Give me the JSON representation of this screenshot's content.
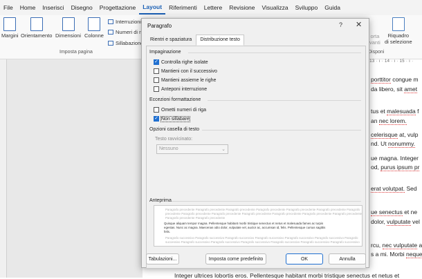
{
  "menu": {
    "tabs": [
      "File",
      "Home",
      "Inserisci",
      "Disegno",
      "Progettazione",
      "Layout",
      "Riferimenti",
      "Lettere",
      "Revisione",
      "Visualizza",
      "Sviluppo",
      "Guida"
    ],
    "active": "Layout"
  },
  "ribbon": {
    "margini": "Margini",
    "orientamento": "Orientamento",
    "dimensioni": "Dimensioni",
    "colonne": "Colonne",
    "interruzioni": "Interruzioni",
    "numeri": "Numeri di r",
    "sillabazione": "Sillabazione",
    "group_label": "Imposta pagina",
    "porta": "orta",
    "avanti": "vanti",
    "riquadro": "Riquadro",
    "di_selezione": "di selezione",
    "disponi": "Disponi"
  },
  "document": {
    "ruler": "· 13 · ı · 14 · ı · 15 · ı ·",
    "lines": [
      {
        "text": "porttitor congue m",
        "squiggle": "porttitor"
      },
      {
        "text": "da libero, sit amet",
        "squiggle": "amet"
      },
      {
        "text": "tus et malesuada f",
        "squiggle": "malesuada"
      },
      {
        "text": "an nec lorem.",
        "squiggle": "nec lorem."
      },
      {
        "text": "celerisque at, vulp",
        "squiggle": "celerisque"
      },
      {
        "text": "nd. Ut nonummy.",
        "squiggle": "nonummy."
      },
      {
        "text": "ue magna. Integer",
        "squiggle": ""
      },
      {
        "text": "od, purus ipsum pr",
        "squiggle": "purus ipsum pr"
      },
      {
        "text": "erat volutpat. Sed",
        "squiggle": "erat volutpat."
      },
      {
        "text": "ue senectus et ne",
        "squiggle": "ue senectus"
      },
      {
        "text": "dolor, vulputate vel",
        "squiggle": "vulputate"
      },
      {
        "text": "rcu, nec vulputate a",
        "squiggle": "nec vulputate"
      },
      {
        "text": "s a mi. Morbi neque",
        "squiggle": "neque"
      }
    ],
    "bottom_line": "Integer ultrices lobortis eros. Pellentesque habitant morbi tristique senectus et netus et"
  },
  "dialog": {
    "title": "Paragrafo",
    "help": "?",
    "close": "✕",
    "tabs": [
      "Rientri e spaziatura",
      "Distribuzione testo"
    ],
    "active_tab": "Distribuzione testo",
    "impaginazione": {
      "heading": "Impaginazione",
      "options": [
        {
          "label": "Controlla righe isolate",
          "checked": true
        },
        {
          "label": "Mantieni con il successivo",
          "checked": false
        },
        {
          "label": "Mantieni assieme le righe",
          "checked": false
        },
        {
          "label": "Anteponi interruzione",
          "checked": false
        }
      ]
    },
    "eccezioni": {
      "heading": "Eccezioni formattazione",
      "options": [
        {
          "label": "Ometti numeri di riga",
          "checked": false
        },
        {
          "label": "Non sillabare",
          "checked": true
        }
      ]
    },
    "casella": {
      "heading": "Opzioni casella di testo",
      "testo_label": "Testo ravvicinato:",
      "select_value": "Nessuno"
    },
    "anteprima": {
      "heading": "Anteprima",
      "grey_top": [
        "Paragrafo precedente Paragrafo precedente Paragrafo precedente Paragrafo precedente Paragrafo precedente Paragrafo precedente Paragrafo",
        "precedente Paragrafo precedente Paragrafo precedente Paragrafo precedente Paragrafo precedente Paragrafo precedente Paragrafo precedente",
        "Paragrafo precedente Paragrafo precedente"
      ],
      "dark": [
        "Quisque aliquam tempor magna. Pellentesque habitant morbi tristique senectus et netus et malesuada fames ac turpis",
        "egestas. Nunc ac magna. Maecenas odio dolor, vulputate vel, auctor ac, accumsan id, felis. Pellentesque cursus sagittis",
        "felis."
      ],
      "grey_bottom": [
        "Paragrafo successivo Paragrafo successivo Paragrafo successivo Paragrafo successivo Paragrafo successivo Paragrafo successivo Paragrafo",
        "successivo Paragrafo successivo Paragrafo successivo Paragrafo successivo Paragrafo successivo Paragrafo successivo Paragrafo successivo"
      ]
    },
    "buttons": {
      "tabulazioni": "Tabulazioni...",
      "predefinito": "Imposta come predefinito",
      "ok": "OK",
      "annulla": "Annulla"
    }
  }
}
